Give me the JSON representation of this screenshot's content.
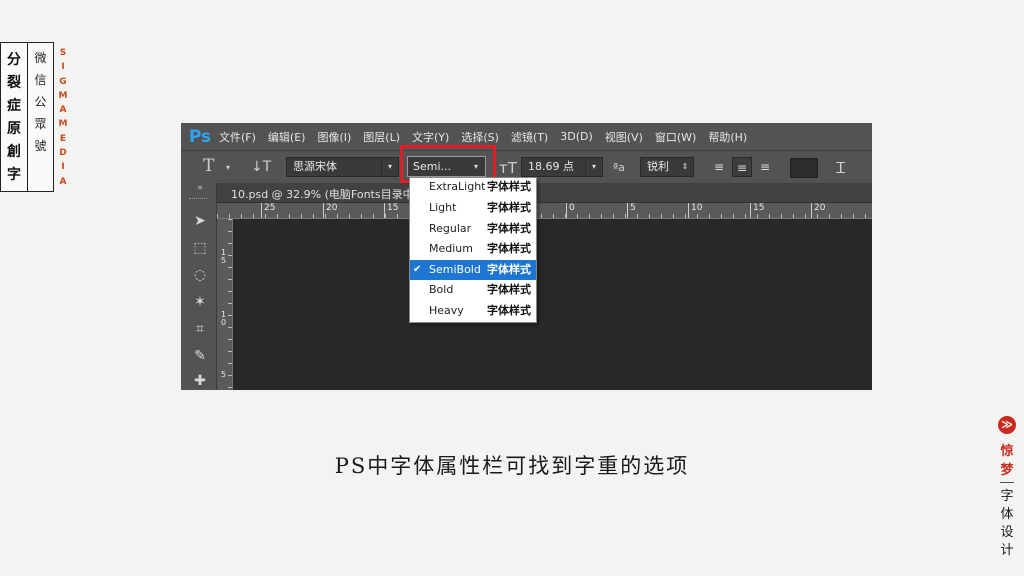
{
  "brand_left": {
    "col1": [
      "分",
      "裂",
      "症",
      "原",
      "創",
      "字"
    ],
    "col2": [
      "微",
      "信",
      "公",
      "眾",
      "號"
    ],
    "sigma": [
      "S",
      "I",
      "G",
      "M",
      "A",
      "M",
      "E",
      "D",
      "I",
      "A"
    ]
  },
  "ps": {
    "logo": "Ps",
    "menu": [
      "文件(F)",
      "编辑(E)",
      "图像(I)",
      "图层(L)",
      "文字(Y)",
      "选择(S)",
      "滤镜(T)",
      "3D(D)",
      "视图(V)",
      "窗口(W)",
      "帮助(H)"
    ],
    "options": {
      "font_family": "思源宋体",
      "font_weight": "Semi...",
      "font_size": "18.69 点",
      "aa_icon_text": "ªa",
      "antialias": "锐利"
    },
    "document_tab": "10.psd @ 32.9% (电脑Fonts目录中",
    "ruler_h_ticks": [
      "25",
      "20",
      "15",
      "0",
      "5",
      "10",
      "15",
      "20"
    ],
    "ruler_v_ticks": [
      "1\n5",
      "1\n0",
      "5"
    ],
    "dropdown": {
      "preview": "字体样式",
      "check": "✔",
      "items": [
        "ExtraLight",
        "Light",
        "Regular",
        "Medium",
        "SemiBold",
        "Bold",
        "Heavy"
      ],
      "selected": "SemiBold"
    },
    "colors": {
      "ui_gray": "#535353",
      "canvas": "#282828",
      "highlight": "#e01d24",
      "selection": "#1e76d3",
      "logo_blue": "#2fa3f0"
    }
  },
  "caption": "PS中字体属性栏可找到字重的选项",
  "brand_right": {
    "logo_glyph": "≫",
    "red": [
      "惊",
      "梦"
    ],
    "dark": [
      "字",
      "体",
      "设",
      "计"
    ]
  }
}
